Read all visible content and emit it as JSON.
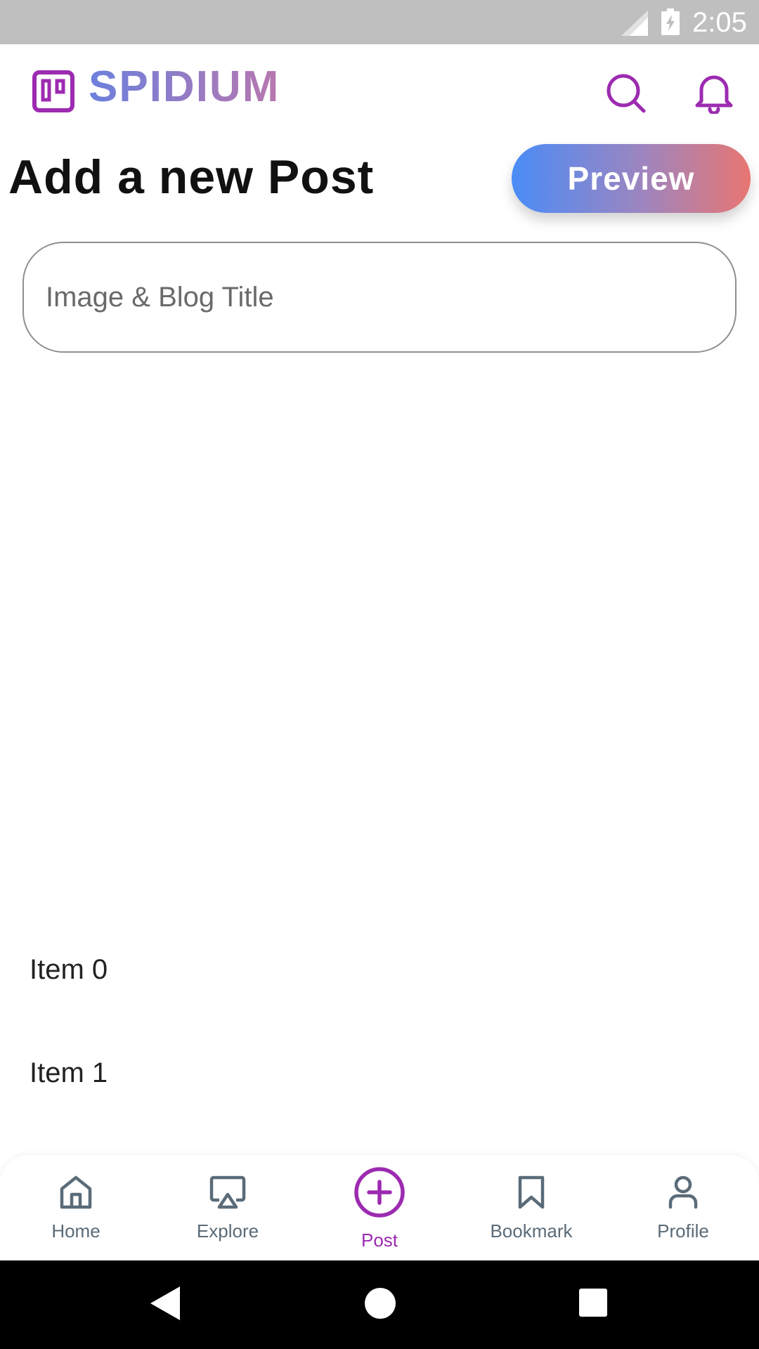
{
  "status_bar": {
    "time": "2:05"
  },
  "header": {
    "app_name": "SPIDIUM"
  },
  "page": {
    "title": "Add a new Post",
    "preview_label": "Preview",
    "title_input_placeholder": "Image & Blog Title"
  },
  "list": {
    "items": [
      "Item 0",
      "Item 1"
    ]
  },
  "bottom_nav": {
    "items": [
      {
        "label": "Home",
        "icon": "home-icon"
      },
      {
        "label": "Explore",
        "icon": "cast-icon"
      },
      {
        "label": "Post",
        "icon": "add-circle-icon",
        "active": true
      },
      {
        "label": "Bookmark",
        "icon": "bookmark-icon"
      },
      {
        "label": "Profile",
        "icon": "user-icon"
      }
    ]
  },
  "colors": {
    "brand_purple": "#9c2bb0",
    "nav_inactive": "#5a6b78",
    "gradient_start": "#4a8cf7",
    "gradient_end": "#e87672"
  }
}
